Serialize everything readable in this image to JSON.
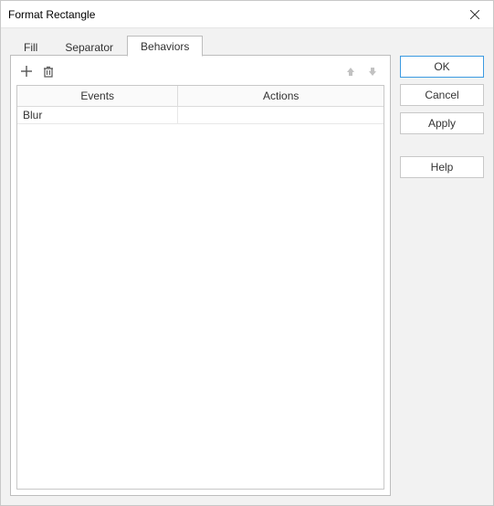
{
  "dialog": {
    "title": "Format Rectangle"
  },
  "tabs": {
    "fill": "Fill",
    "separator": "Separator",
    "behaviors": "Behaviors",
    "active": "behaviors"
  },
  "grid": {
    "columns": {
      "events": "Events",
      "actions": "Actions"
    },
    "rows": [
      {
        "event": "Blur",
        "action": ""
      }
    ]
  },
  "buttons": {
    "ok": "OK",
    "cancel": "Cancel",
    "apply": "Apply",
    "help": "Help"
  }
}
